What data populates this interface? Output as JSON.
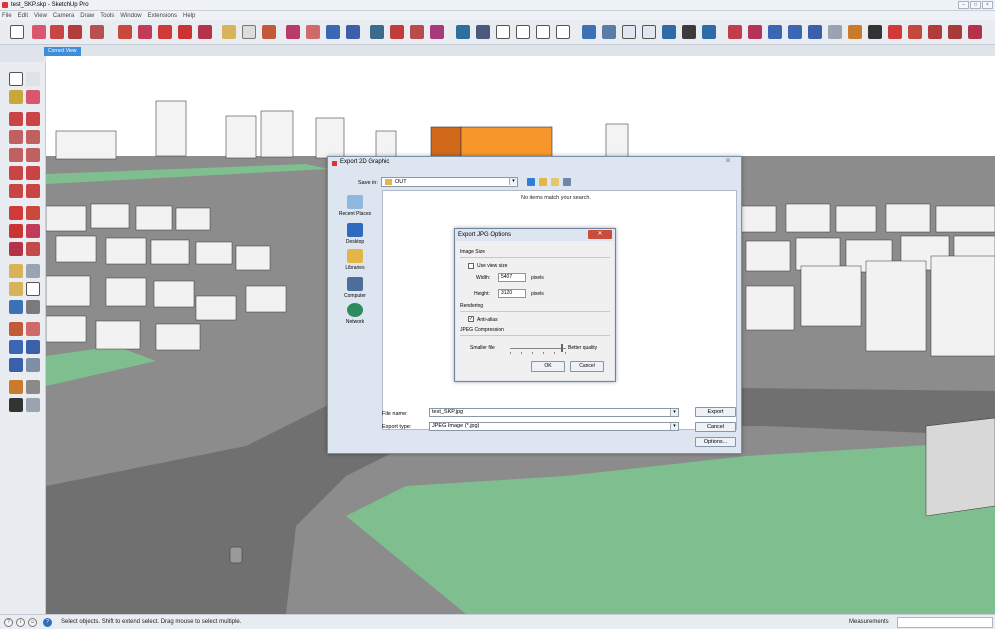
{
  "window": {
    "title": "test_SKP.skp - SketchUp Pro"
  },
  "menu": [
    "File",
    "Edit",
    "View",
    "Camera",
    "Draw",
    "Tools",
    "Window",
    "Extensions",
    "Help"
  ],
  "scene_tab": "Correct View",
  "status": {
    "text": "Select objects. Shift to extend select. Drag mouse to select multiple.",
    "measurements_label": "Measurements",
    "measurements_value": ""
  },
  "export_dialog": {
    "title": "Export 2D Graphic",
    "save_in_label": "Save in:",
    "save_in_value": "OUT",
    "empty_message": "No items match your search.",
    "places": [
      "Recent Places",
      "Desktop",
      "Libraries",
      "Computer",
      "Network"
    ],
    "file_name_label": "File name:",
    "file_name_value": "test_SKP.jpg",
    "export_type_label": "Export type:",
    "export_type_value": "JPEG Image (*.jpg)",
    "buttons": {
      "export": "Export",
      "cancel": "Cancel",
      "options": "Options..."
    }
  },
  "jpg_options": {
    "title": "Export JPG Options",
    "image_size_label": "Image Size",
    "use_view_size_label": "Use view size",
    "use_view_size_checked": false,
    "width_label": "Width:",
    "width_value": "5407",
    "height_label": "Height:",
    "height_value": "3120",
    "units": "pixels",
    "rendering_label": "Rendering",
    "antialias_label": "Anti-alias",
    "antialias_checked": true,
    "compression_label": "JPEG Compression",
    "smaller_label": "Smaller file",
    "better_label": "Better quality",
    "quality_fraction": 0.94,
    "ok": "OK",
    "cancel": "Cancel"
  }
}
